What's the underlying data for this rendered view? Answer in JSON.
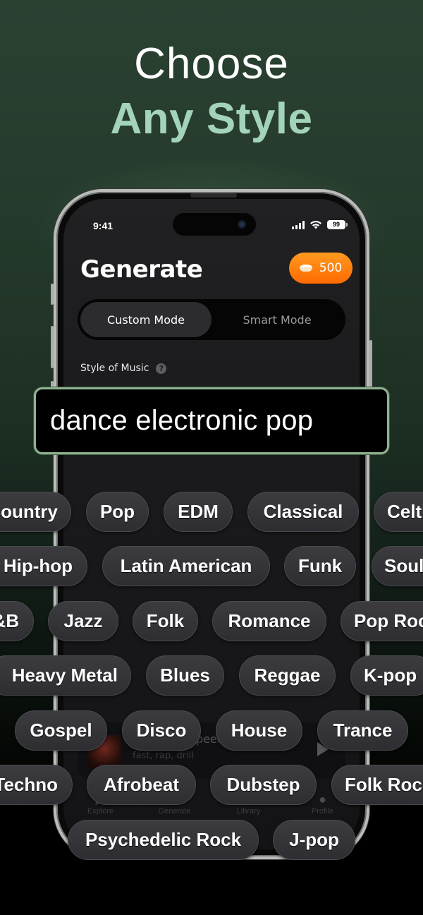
{
  "headline": {
    "line1": "Choose",
    "line2": "Any Style"
  },
  "colors": {
    "accent_green": "#a3d4b9",
    "coin_orange": "#ff7a00",
    "field_border": "#8fb391",
    "chip_bg": "#36363a"
  },
  "status_bar": {
    "time": "9:41",
    "battery": "99",
    "icons": [
      "signal-icon",
      "wifi-icon",
      "battery-icon"
    ]
  },
  "app": {
    "title": "Generate",
    "credits": "500",
    "credits_icon": "coin-icon",
    "mode_tabs": [
      {
        "label": "Custom Mode",
        "active": true
      },
      {
        "label": "Smart Mode",
        "active": false
      }
    ],
    "style_label": "Style of Music",
    "help_icon": "?",
    "style_value": "dance electronic pop",
    "mini_player": {
      "title": "Lightning Speed",
      "subtitle": "fast, rap, drill"
    },
    "tabbar": [
      {
        "label": "Explore",
        "icon": "play-icon"
      },
      {
        "label": "Generate",
        "icon": "music-note-icon"
      },
      {
        "label": "Library",
        "icon": "library-icon"
      },
      {
        "label": "Profile",
        "icon": "person-icon"
      }
    ]
  },
  "chips": [
    {
      "label": "Country"
    },
    {
      "label": "Pop"
    },
    {
      "label": "EDM"
    },
    {
      "label": "Classical"
    },
    {
      "label": "Celtic"
    },
    {
      "label": "Hip-hop"
    },
    {
      "label": "Latin American"
    },
    {
      "label": "Funk"
    },
    {
      "label": "Soul"
    },
    {
      "label": "R&B"
    },
    {
      "label": "Jazz"
    },
    {
      "label": "Folk"
    },
    {
      "label": "Romance"
    },
    {
      "label": "Pop Rock"
    },
    {
      "label": "Heavy Metal"
    },
    {
      "label": "Blues"
    },
    {
      "label": "Reggae"
    },
    {
      "label": "K-pop"
    },
    {
      "label": "Gospel"
    },
    {
      "label": "Disco"
    },
    {
      "label": "House"
    },
    {
      "label": "Trance"
    },
    {
      "label": "Techno"
    },
    {
      "label": "Afrobeat"
    },
    {
      "label": "Dubstep"
    },
    {
      "label": "Folk Rock"
    },
    {
      "label": "Psychedelic Rock"
    },
    {
      "label": "J-pop"
    }
  ]
}
